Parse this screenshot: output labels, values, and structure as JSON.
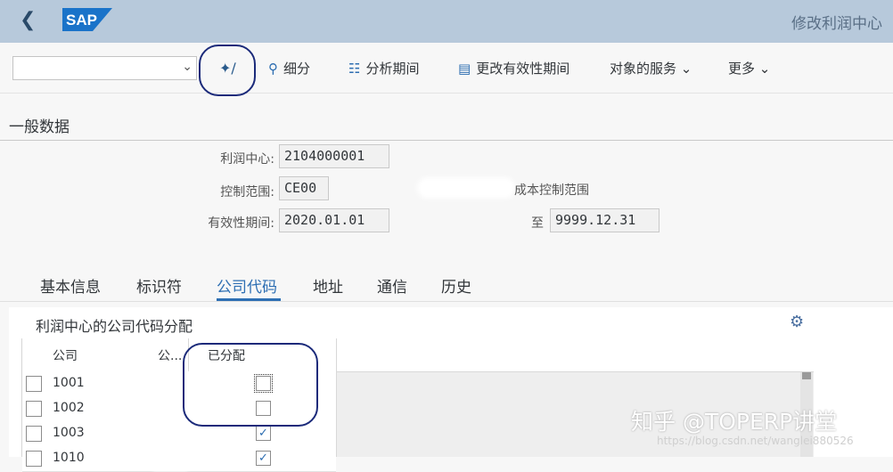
{
  "header": {
    "title": "修改利润中心",
    "logo_text": "SAP"
  },
  "toolbar": {
    "dropdown_value": "",
    "items": [
      {
        "label": "细分",
        "icon": "zoom-icon"
      },
      {
        "label": "分析期间",
        "icon": "hierarchy-icon"
      },
      {
        "label": "更改有效性期间",
        "icon": "calendar-icon"
      },
      {
        "label": "对象的服务",
        "icon": "chevron-down-icon"
      },
      {
        "label": "更多",
        "icon": "chevron-down-icon"
      }
    ]
  },
  "general": {
    "section_title": "一般数据",
    "fields": [
      {
        "label": "利润中心:",
        "value": "2104000001"
      },
      {
        "label": "控制范围:",
        "value": "CE00"
      },
      {
        "label": "有效性期间:",
        "value": "2020.01.01"
      }
    ],
    "controlling_area_desc": "成本控制范围",
    "to_label": "至",
    "valid_to": "9999.12.31"
  },
  "tabs": [
    "基本信息",
    "标识符",
    "公司代码",
    "地址",
    "通信",
    "历史"
  ],
  "active_tab": "公司代码",
  "company_assignment": {
    "title": "利润中心的公司代码分配",
    "columns": [
      "公司",
      "公...",
      "已分配"
    ],
    "rows": [
      {
        "code": "1001",
        "assigned": false
      },
      {
        "code": "1002",
        "assigned": false
      },
      {
        "code": "1003",
        "assigned": true
      },
      {
        "code": "1010",
        "assigned": true
      }
    ]
  },
  "watermark": {
    "text": "知乎 @TOPERP讲堂",
    "url": "https://blog.csdn.net/wanglei880526"
  },
  "colors": {
    "shell_bar": "#b7c9db",
    "accent": "#2e6fb3",
    "annotation": "#1b2a7a"
  }
}
